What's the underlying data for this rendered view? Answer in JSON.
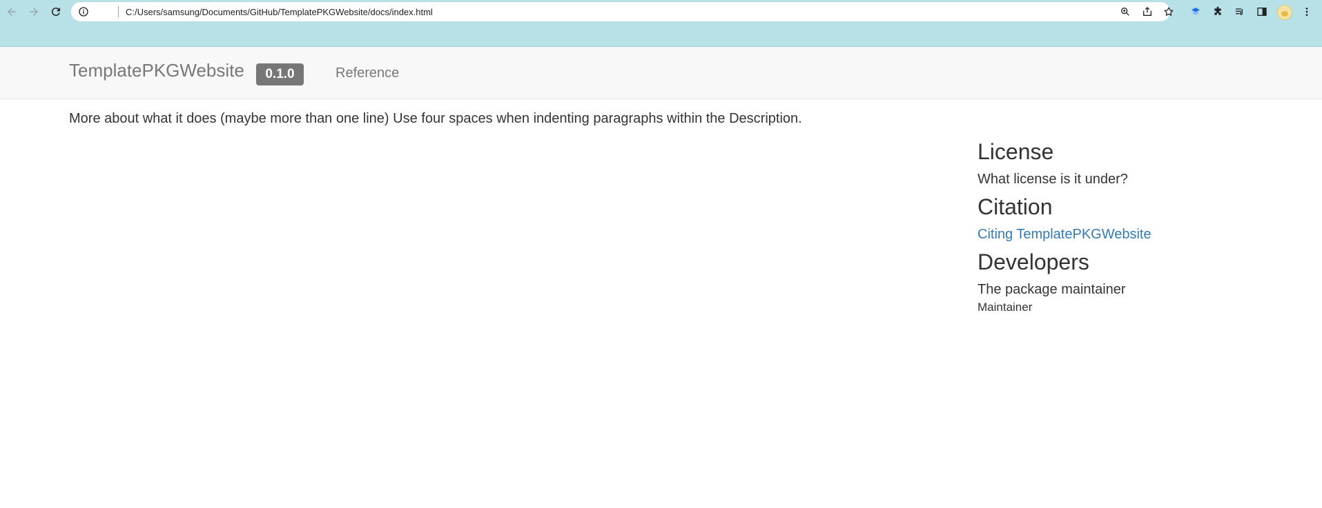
{
  "browser": {
    "url": "C:/Users/samsung/Documents/GitHub/TemplatePKGWebsite/docs/index.html",
    "chrome_color": "#b7e1e6"
  },
  "navbar": {
    "brand": "TemplatePKGWebsite",
    "version": "0.1.0",
    "links": [
      "Reference"
    ]
  },
  "main": {
    "description": "More about what it does (maybe more than one line) Use four spaces when indenting paragraphs within the Description."
  },
  "sidebar": {
    "license_heading": "License",
    "license_text": "What license is it under?",
    "citation_heading": "Citation",
    "citation_link": "Citing TemplatePKGWebsite",
    "developers_heading": "Developers",
    "developer_name": "The package maintainer",
    "developer_role": "Maintainer"
  },
  "colors": {
    "link": "#337ab7",
    "text": "#333333",
    "muted": "#777777",
    "navbar_bg": "#f8f8f8"
  }
}
